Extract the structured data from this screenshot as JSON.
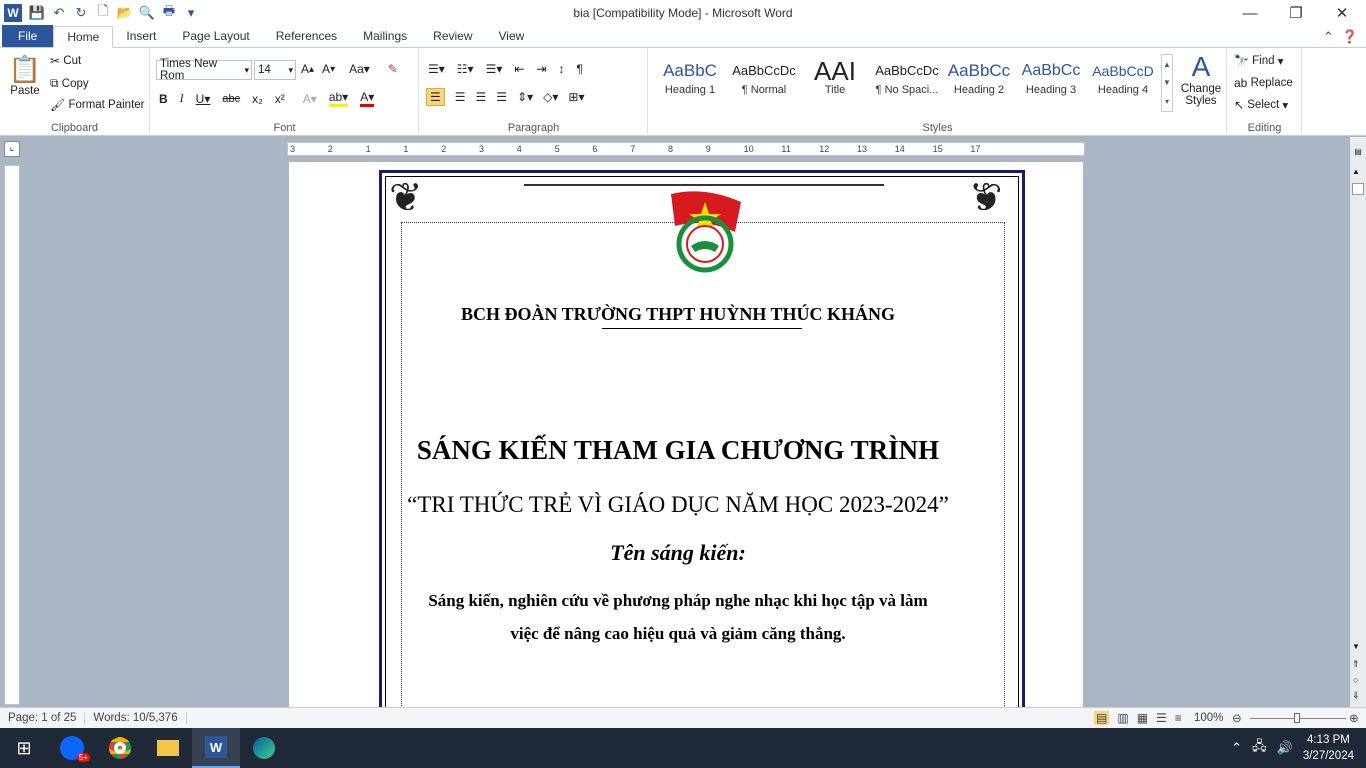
{
  "app": {
    "window_title": "bia [Compatibility Mode]  -  Microsoft Word",
    "logo_letter": "W"
  },
  "tabs": [
    "File",
    "Home",
    "Insert",
    "Page Layout",
    "References",
    "Mailings",
    "Review",
    "View"
  ],
  "clipboard": {
    "paste": "Paste",
    "cut": "Cut",
    "copy": "Copy",
    "format_painter": "Format Painter",
    "label": "Clipboard"
  },
  "font": {
    "name": "Times New Rom",
    "size": "14",
    "label": "Font"
  },
  "paragraph": {
    "label": "Paragraph"
  },
  "styles": {
    "label": "Styles",
    "items": [
      {
        "sample": "AaBbC",
        "name": "Heading 1"
      },
      {
        "sample": "AaBbCcDc",
        "name": "¶ Normal"
      },
      {
        "sample": "AAI",
        "name": "Title"
      },
      {
        "sample": "AaBbCcDc",
        "name": "¶ No Spaci..."
      },
      {
        "sample": "AaBbCc",
        "name": "Heading 2"
      },
      {
        "sample": "AaBbCc",
        "name": "Heading 3"
      },
      {
        "sample": "AaBbCcD",
        "name": "Heading 4"
      }
    ],
    "change_styles": "Change Styles"
  },
  "editing": {
    "find": "Find",
    "replace": "Replace",
    "select": "Select",
    "label": "Editing"
  },
  "document": {
    "org": "BCH ĐOÀN TRƯỜNG THPT HUỲNH THÚC KHÁNG",
    "title1": "SÁNG KIẾN THAM GIA CHƯƠNG TRÌNH",
    "title2": "“TRI THỨC TRẺ VÌ GIÁO DỤC NĂM HỌC 2023-2024”",
    "subtitle": "Tên sáng kiến:",
    "body_line1": "Sáng kiến, nghiên  cứu về phương pháp  nghe nhạc khi học tập và làm",
    "body_line2": "việc để nâng cao hiệu quả và giảm  căng thẳng."
  },
  "ruler": [
    "3",
    "2",
    "1",
    "1",
    "2",
    "3",
    "4",
    "5",
    "6",
    "7",
    "8",
    "9",
    "10",
    "11",
    "12",
    "13",
    "14",
    "15",
    "17"
  ],
  "status": {
    "page": "Page: 1 of 25",
    "words": "Words: 10/5,376",
    "zoom": "100%"
  },
  "taskbar": {
    "time": "4:13 PM",
    "date": "3/27/2024",
    "zalo_badge": "5+"
  }
}
